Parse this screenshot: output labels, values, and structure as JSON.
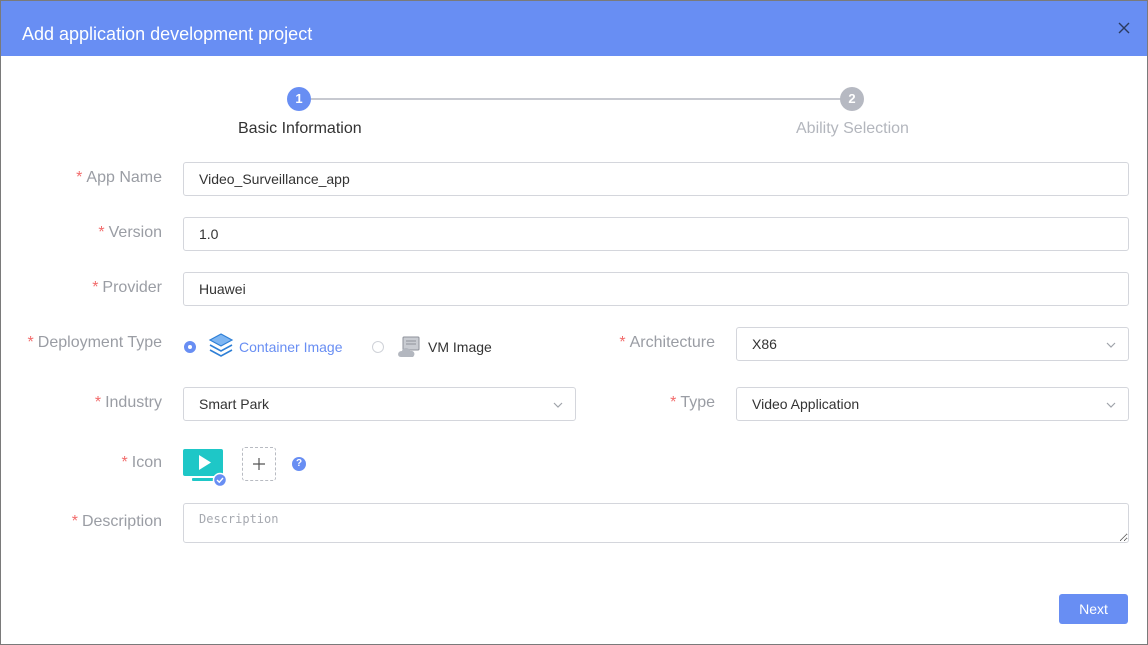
{
  "dialog": {
    "title": "Add application development project"
  },
  "steps": [
    {
      "number": "1",
      "label": "Basic Information",
      "state": "active"
    },
    {
      "number": "2",
      "label": "Ability Selection",
      "state": "inactive"
    }
  ],
  "form": {
    "required_mark": "*",
    "app_name": {
      "label": "App Name",
      "value": "Video_Surveillance_app"
    },
    "version": {
      "label": "Version",
      "value": "1.0"
    },
    "provider": {
      "label": "Provider",
      "value": "Huawei"
    },
    "deployment_type": {
      "label": "Deployment Type",
      "options": [
        {
          "label": "Container Image",
          "selected": true,
          "icon": "layers-icon"
        },
        {
          "label": "VM Image",
          "selected": false,
          "icon": "vm-cloud-icon"
        }
      ]
    },
    "architecture": {
      "label": "Architecture",
      "value": "X86"
    },
    "industry": {
      "label": "Industry",
      "value": "Smart Park"
    },
    "type": {
      "label": "Type",
      "value": "Video Application"
    },
    "icon": {
      "label": "Icon",
      "help": "?"
    },
    "description": {
      "label": "Description",
      "placeholder": "Description",
      "value": ""
    }
  },
  "footer": {
    "next_label": "Next"
  },
  "colors": {
    "primary": "#688ef3",
    "required": "#f26b6b",
    "teal": "#1ec7c7"
  }
}
